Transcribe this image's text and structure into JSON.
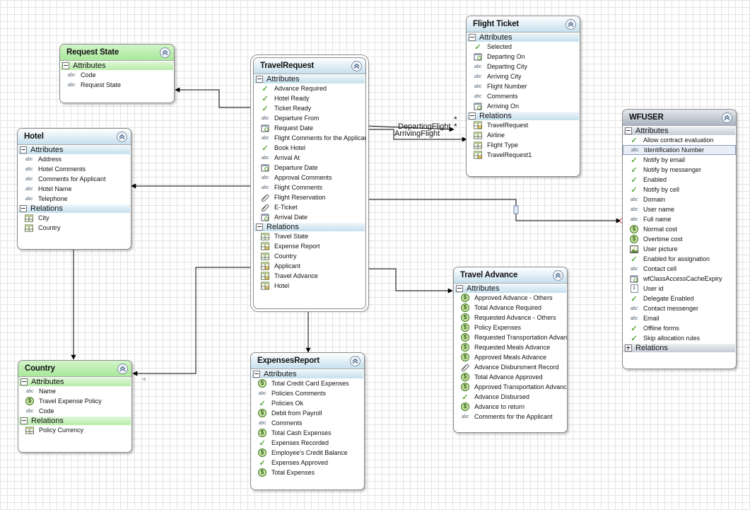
{
  "section_labels": {
    "attributes": "Attributes",
    "relations": "Relations"
  },
  "connector_labels": {
    "departing": "DepartingFlight",
    "arriving": "ArrivingFlight",
    "mult_a": "*",
    "mult_b": "*"
  },
  "entities": [
    {
      "key": "request_state",
      "title": "Request State",
      "theme": "grn",
      "attributes": [
        {
          "icon": "abc",
          "label": "Code"
        },
        {
          "icon": "abc",
          "label": "Request State"
        }
      ],
      "relations": null
    },
    {
      "key": "hotel",
      "title": "Hotel",
      "theme": "blu",
      "attributes": [
        {
          "icon": "abc",
          "label": "Address"
        },
        {
          "icon": "abc",
          "label": "Hotel Comments"
        },
        {
          "icon": "abc",
          "label": "Comments for Applicant"
        },
        {
          "icon": "abc",
          "label": "Hotel Name"
        },
        {
          "icon": "abc",
          "label": "Telephone"
        }
      ],
      "relations": [
        {
          "icon": "table",
          "label": "City"
        },
        {
          "icon": "table",
          "label": "Country"
        }
      ]
    },
    {
      "key": "country",
      "title": "Country",
      "theme": "grn",
      "attributes": [
        {
          "icon": "abc",
          "label": "Name"
        },
        {
          "icon": "dollar",
          "label": "Travel Expense Policy"
        },
        {
          "icon": "abc",
          "label": "Code"
        }
      ],
      "relations": [
        {
          "icon": "table",
          "label": "Policy Currency"
        }
      ]
    },
    {
      "key": "travel_request",
      "title": "TravelRequest",
      "theme": "blu",
      "attributes": [
        {
          "icon": "check",
          "label": "Advance Required"
        },
        {
          "icon": "check",
          "label": "Hotel Ready"
        },
        {
          "icon": "check",
          "label": "Ticket Ready"
        },
        {
          "icon": "abc",
          "label": "Departure From"
        },
        {
          "icon": "calendar",
          "label": "Request Date"
        },
        {
          "icon": "abc",
          "label": "Flight Comments for the Applicant"
        },
        {
          "icon": "check",
          "label": "Book Hotel"
        },
        {
          "icon": "abc",
          "label": "Arrival At"
        },
        {
          "icon": "calendar",
          "label": "Departure Date"
        },
        {
          "icon": "abc",
          "label": "Approval Comments"
        },
        {
          "icon": "abc",
          "label": "Flight Comments"
        },
        {
          "icon": "clip",
          "label": "Flight Reservation"
        },
        {
          "icon": "clip",
          "label": "E-Ticket"
        },
        {
          "icon": "calendar",
          "label": "Arrival Date"
        }
      ],
      "relations": [
        {
          "icon": "table",
          "label": "Travel State"
        },
        {
          "icon": "tablex",
          "label": "Expense Report"
        },
        {
          "icon": "table",
          "label": "Country"
        },
        {
          "icon": "tablex",
          "label": "Applicant"
        },
        {
          "icon": "tablex",
          "label": "Travel Advance"
        },
        {
          "icon": "tablex",
          "label": "Hotel"
        }
      ]
    },
    {
      "key": "expenses_report",
      "title": "ExpensesReport",
      "theme": "blu",
      "attributes": [
        {
          "icon": "dollar",
          "label": "Total Credit Card Expenses"
        },
        {
          "icon": "abc",
          "label": "Policies Comments"
        },
        {
          "icon": "check",
          "label": "Policies Ok"
        },
        {
          "icon": "dollar",
          "label": "Debit from Payroll"
        },
        {
          "icon": "abc",
          "label": "Comments"
        },
        {
          "icon": "dollar",
          "label": "Total Cash Expenses"
        },
        {
          "icon": "check",
          "label": "Expenses Recorded"
        },
        {
          "icon": "dollar",
          "label": "Employee's Credit Balance"
        },
        {
          "icon": "check",
          "label": "Expenses Approved"
        },
        {
          "icon": "dollar",
          "label": "Total Expenses"
        }
      ],
      "relations": null
    },
    {
      "key": "flight_ticket",
      "title": "Flight Ticket",
      "theme": "blu",
      "attributes": [
        {
          "icon": "check",
          "label": "Selected"
        },
        {
          "icon": "calendar",
          "label": "Departing On"
        },
        {
          "icon": "abc",
          "label": "Departing City"
        },
        {
          "icon": "abc",
          "label": "Arriving City"
        },
        {
          "icon": "abc",
          "label": "Flight Number"
        },
        {
          "icon": "abc",
          "label": "Comments"
        },
        {
          "icon": "calendar",
          "label": "Arriving On"
        }
      ],
      "relations": [
        {
          "icon": "tablex",
          "label": "TravelRequest"
        },
        {
          "icon": "table",
          "label": "Airline"
        },
        {
          "icon": "table",
          "label": "Flight Type"
        },
        {
          "icon": "tablex",
          "label": "TravelRequest1"
        }
      ]
    },
    {
      "key": "travel_advance",
      "title": "Travel Advance",
      "theme": "blu",
      "attributes": [
        {
          "icon": "dollar",
          "label": "Approved Advance - Others"
        },
        {
          "icon": "dollar",
          "label": "Total Advance Required"
        },
        {
          "icon": "dollar",
          "label": "Requested Advance - Others"
        },
        {
          "icon": "dollar",
          "label": "Policy Expenses"
        },
        {
          "icon": "dollar",
          "label": "Requested Transportation Advance"
        },
        {
          "icon": "dollar",
          "label": "Requested Meals Advance"
        },
        {
          "icon": "dollar",
          "label": "Approved Meals Advance"
        },
        {
          "icon": "clip",
          "label": "Advance Disbursment Record"
        },
        {
          "icon": "dollar",
          "label": "Total Advance Approved"
        },
        {
          "icon": "dollar",
          "label": "Approved Transportation Advance"
        },
        {
          "icon": "check",
          "label": "Advance Disbursed"
        },
        {
          "icon": "dollar",
          "label": "Advance to return"
        },
        {
          "icon": "abc",
          "label": "Comments for the Applicant"
        }
      ],
      "relations": null
    },
    {
      "key": "wfuser",
      "title": "WFUSER",
      "theme": "gry",
      "attributes": [
        {
          "icon": "check",
          "label": "Allow contract evaluation"
        },
        {
          "icon": "abc",
          "label": "Identification Number"
        },
        {
          "icon": "check",
          "label": "Notify by email"
        },
        {
          "icon": "check",
          "label": "Notify by messenger"
        },
        {
          "icon": "check",
          "label": "Enabled"
        },
        {
          "icon": "check",
          "label": "Notify by cell"
        },
        {
          "icon": "abc",
          "label": "Domain"
        },
        {
          "icon": "abc",
          "label": "User name"
        },
        {
          "icon": "abc",
          "label": "Full name"
        },
        {
          "icon": "dollar",
          "label": "Normal cost"
        },
        {
          "icon": "dollar",
          "label": "Overtime cost"
        },
        {
          "icon": "picture",
          "label": "User picture"
        },
        {
          "icon": "check",
          "label": "Enabled for assignation"
        },
        {
          "icon": "abc",
          "label": "Contact cell"
        },
        {
          "icon": "calendar",
          "label": "wfClassAccessCacheExpiry"
        },
        {
          "icon": "number",
          "label": "User id"
        },
        {
          "icon": "check",
          "label": "Delegate Enabled"
        },
        {
          "icon": "abc",
          "label": "Contact messenger"
        },
        {
          "icon": "abc",
          "label": "Email"
        },
        {
          "icon": "check",
          "label": "Offline forms"
        },
        {
          "icon": "check",
          "label": "Skip allocation rules"
        }
      ],
      "relations": [],
      "relations_collapsed": true
    }
  ]
}
